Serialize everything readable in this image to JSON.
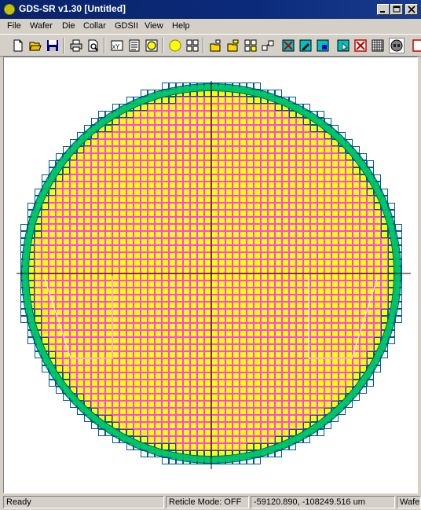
{
  "window": {
    "title": "GDS-SR v1.30 [Untitled]",
    "minimize_label": "minimize",
    "maximize_label": "maximize",
    "close_label": "close"
  },
  "menu": {
    "items": [
      "File",
      "Wafer",
      "Die",
      "Collar",
      "GDSII",
      "View",
      "Help"
    ]
  },
  "toolbar": {
    "buttons": [
      "new-icon",
      "open-icon",
      "save-icon",
      "print-icon",
      "print-preview-icon",
      "xy-icon",
      "die-list-icon",
      "wafer-yellow-icon",
      "yellow-circle-icon",
      "grid-array-icon",
      "open-gds-icon",
      "open-gds-alt-icon",
      "reticle-icon",
      "shift-die-icon",
      "delete-die-icon",
      "edit-die-icon",
      "color-die-icon",
      "select-die-icon",
      "remove-die-icon",
      "grid-icon",
      "dark-wafer-icon"
    ]
  },
  "status": {
    "ready": "Ready",
    "reticle_mode": "Reticle Mode: OFF",
    "coordinates": "-59120.890, -108249.516 um",
    "wafer_pane": "Wafer D"
  },
  "colors": {
    "die_fill": "#ffff00",
    "die_border": "#ff40ff",
    "edge_die_border": "#005a8c",
    "collar_ring": "#00c864",
    "crosshair": "#000000",
    "title_bar": "#0a246a"
  }
}
